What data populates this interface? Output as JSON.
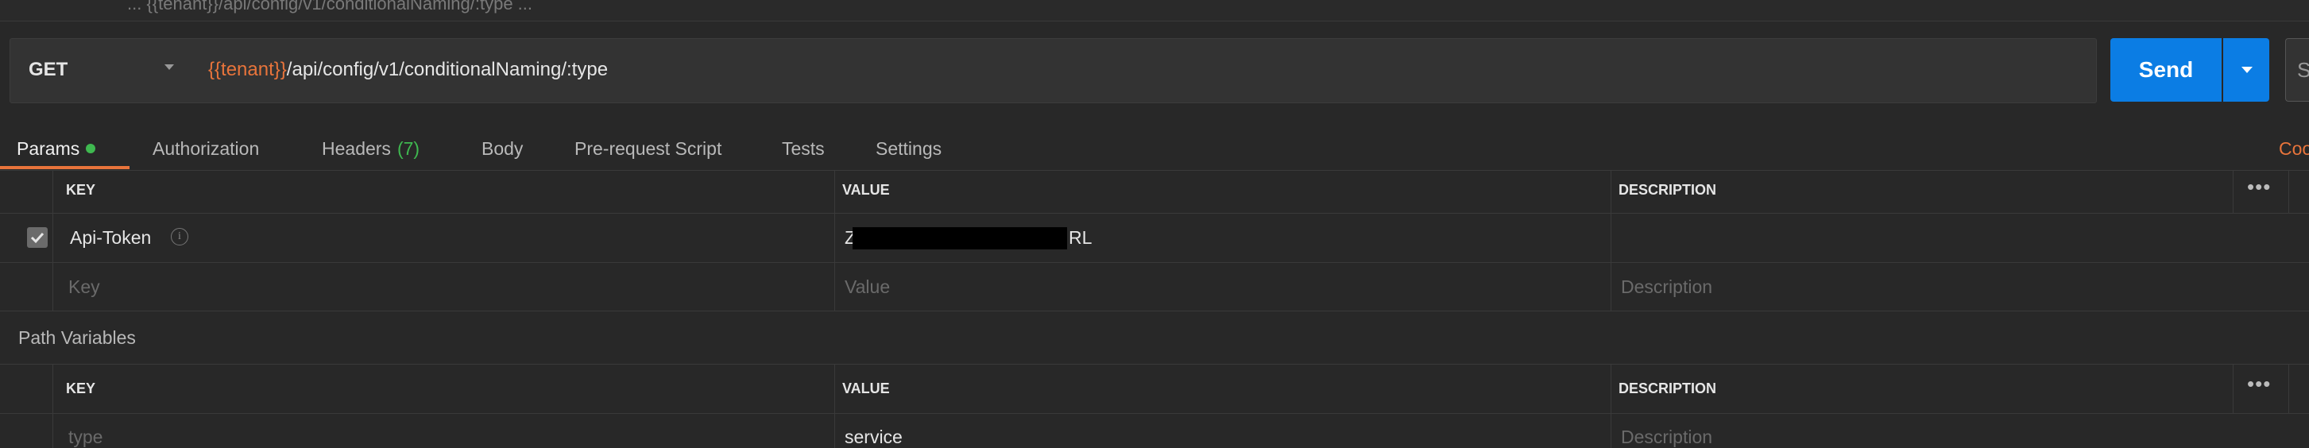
{
  "topbar": {
    "title": "... {{tenant}}/api/config/v1/conditionalNaming/:type ..."
  },
  "request": {
    "method": "GET",
    "url_prefix": "{{tenant}}",
    "url_path": "/api/config/v1/conditionalNaming/:type",
    "send_label": "Send",
    "save_label": "S"
  },
  "tabs": [
    {
      "label": "Params",
      "badge": ""
    },
    {
      "label": "Authorization",
      "badge": ""
    },
    {
      "label": "Headers",
      "badge": "(7)"
    },
    {
      "label": "Body",
      "badge": ""
    },
    {
      "label": "Pre-request Script",
      "badge": ""
    },
    {
      "label": "Tests",
      "badge": ""
    },
    {
      "label": "Settings",
      "badge": ""
    }
  ],
  "code_link": "Coo",
  "query_params": {
    "headers": {
      "key": "KEY",
      "value": "VALUE",
      "description": "DESCRIPTION"
    },
    "rows": [
      {
        "checked": true,
        "key": "Api-Token",
        "value_start": "Z",
        "value_end": "RL",
        "description": ""
      }
    ],
    "placeholder": {
      "key": "Key",
      "value": "Value",
      "description": "Description"
    }
  },
  "path_variables": {
    "title": "Path Variables",
    "headers": {
      "key": "KEY",
      "value": "VALUE",
      "description": "DESCRIPTION"
    },
    "rows": [
      {
        "key": "type",
        "value": "service",
        "description_placeholder": "Description"
      }
    ]
  },
  "colors": {
    "accent": "#e8743b",
    "send": "#0b7de4",
    "status_green": "#3fb950",
    "background": "#282828"
  }
}
